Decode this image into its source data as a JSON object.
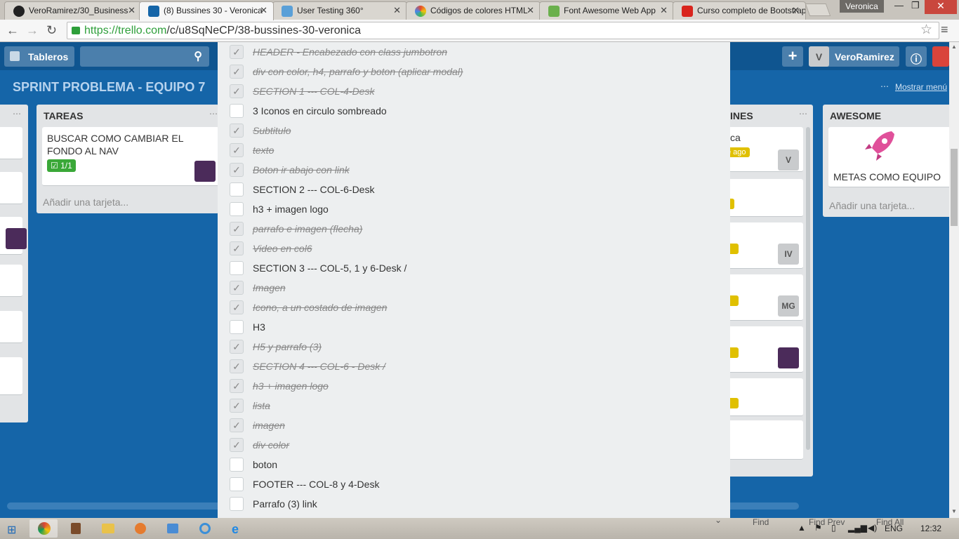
{
  "browser": {
    "tabs": [
      {
        "label": "VeroRamirez/30_Business",
        "icon_color": "#222222"
      },
      {
        "label": "(8) Bussines 30 - Veronica",
        "icon_color": "#1565a8"
      },
      {
        "label": "User Testing 360°",
        "icon_color": "#5aa0d8"
      },
      {
        "label": "Códigos de colores HTML",
        "icon_color": "#e34a2f"
      },
      {
        "label": "Font Awesome Web App",
        "icon_color": "#6ab04c"
      },
      {
        "label": "Curso completo de Bootstrap",
        "icon_color": "#d9251d"
      }
    ],
    "user_badge": "Veronica",
    "url_host": "https://trello.com",
    "url_path": "/c/u8SqNeCP/38-bussines-30-veronica"
  },
  "trello": {
    "boards_label": "Tableros",
    "user_initial": "V",
    "username": "VeroRamirez",
    "board_title": "SPRINT PROBLEMA - EQUIPO 7",
    "show_menu": "Mostrar menú",
    "lists": {
      "tareas": {
        "title": "TAREAS",
        "card_text": "BUSCAR COMO CAMBIAR EL FONDO AL NAV",
        "checklist_badge": "1/1",
        "add_card": "Añadir una tarjeta..."
      },
      "bussines": {
        "title_fragment": "INES",
        "card1_fragment": "ca",
        "card1_badge": "e ago",
        "avatars": [
          "V",
          "IV",
          "MG"
        ]
      },
      "awesome": {
        "title": "AWESOME",
        "card_text": "METAS COMO EQUIPO",
        "add_card": "Añadir una tarjeta..."
      }
    }
  },
  "checklist": [
    {
      "text": "HEADER - Encabezado con class jumbotron",
      "done": true
    },
    {
      "text": "div con color, h4, parrafo y boton (aplicar modal)",
      "done": true
    },
    {
      "text": "SECTION 1 --- COL-4-Desk",
      "done": true
    },
    {
      "text": "3 Iconos en circulo sombreado",
      "done": false
    },
    {
      "text": "Subtitulo",
      "done": true
    },
    {
      "text": "texto",
      "done": true
    },
    {
      "text": "Boton ir abajo con link",
      "done": true
    },
    {
      "text": "SECTION 2 --- COL-6-Desk",
      "done": false
    },
    {
      "text": "h3 + imagen logo",
      "done": false
    },
    {
      "text": "parrafo e imagen (flecha)",
      "done": true
    },
    {
      "text": "Video en col6",
      "done": true
    },
    {
      "text": "SECTION 3 --- COL-5, 1 y 6-Desk /",
      "done": false
    },
    {
      "text": "Imagen ",
      "done": true
    },
    {
      "text": "Icono, a un costado de imagen",
      "done": true
    },
    {
      "text": "H3",
      "done": false
    },
    {
      "text": "H5 y parrafo (3)",
      "done": true
    },
    {
      "text": "SECTION 4 --- COL-6 - Desk /",
      "done": true
    },
    {
      "text": "h3 + imagen logo",
      "done": true
    },
    {
      "text": "lista",
      "done": true
    },
    {
      "text": "imagen",
      "done": true
    },
    {
      "text": "div color",
      "done": true
    },
    {
      "text": "boton",
      "done": false
    },
    {
      "text": "FOOTER --- COL-8 y 4-Desk",
      "done": false
    },
    {
      "text": "Parrafo (3) link",
      "done": false
    }
  ],
  "findbar": {
    "find": "Find",
    "find_prev": "Find Prev",
    "find_all": "Find All"
  },
  "taskbar": {
    "lang": "ENG",
    "time": "12:32"
  }
}
